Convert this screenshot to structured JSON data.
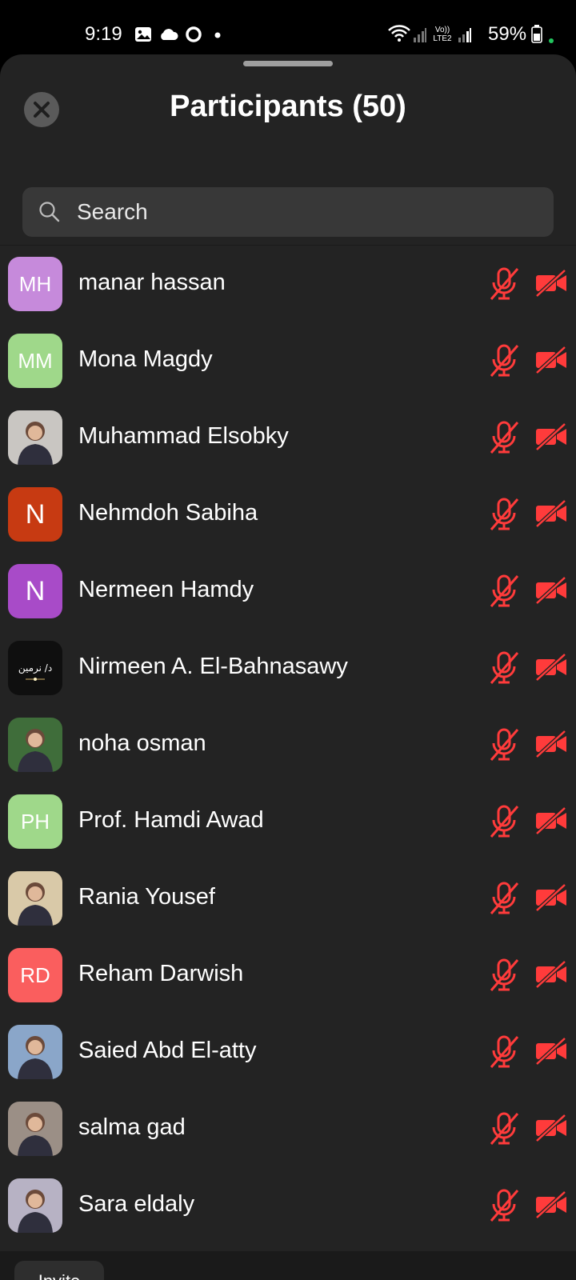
{
  "status_bar": {
    "time": "9:19",
    "battery": "59%",
    "network_label": "Vo)) LTE2",
    "icons": [
      "gallery-icon",
      "cloud-icon",
      "vodafone-icon",
      "dot-icon",
      "wifi-icon",
      "signal-icon",
      "battery-icon"
    ]
  },
  "header": {
    "title": "Participants (50)",
    "close_icon": "close-icon"
  },
  "search": {
    "placeholder": "Search",
    "value": ""
  },
  "colors": {
    "muted_red": "#ff3b3b",
    "sheet_bg": "#232323"
  },
  "participants": [
    {
      "name": "manar hassan",
      "initials": "MH",
      "avatar_color": "#c68adb",
      "avatar_type": "initials",
      "mic": "muted",
      "video": "off"
    },
    {
      "name": "Mona Magdy",
      "initials": "MM",
      "avatar_color": "#9fd88a",
      "avatar_type": "initials",
      "mic": "muted",
      "video": "off"
    },
    {
      "name": "Muhammad Elsobky",
      "initials": "",
      "avatar_color": "#c9c6c2",
      "avatar_type": "photo",
      "mic": "muted",
      "video": "off"
    },
    {
      "name": "Nehmdoh Sabiha",
      "initials": "N",
      "avatar_color": "#c73a12",
      "avatar_type": "initials",
      "mic": "muted",
      "video": "off"
    },
    {
      "name": "Nermeen Hamdy",
      "initials": "N",
      "avatar_color": "#a84bc8",
      "avatar_type": "initials",
      "mic": "muted",
      "video": "off"
    },
    {
      "name": "Nirmeen A. El-Bahnasawy",
      "initials": "",
      "avatar_color": "#0f0f0f",
      "avatar_type": "photo",
      "avatar_text": "د/ نرمين",
      "mic": "muted",
      "video": "off"
    },
    {
      "name": "noha osman",
      "initials": "",
      "avatar_color": "#3f6d3a",
      "avatar_type": "photo",
      "mic": "muted",
      "video": "off"
    },
    {
      "name": "Prof. Hamdi Awad",
      "initials": "PH",
      "avatar_color": "#9fd88a",
      "avatar_type": "initials",
      "mic": "muted",
      "video": "off"
    },
    {
      "name": "Rania Yousef",
      "initials": "",
      "avatar_color": "#d9c9a8",
      "avatar_type": "photo",
      "mic": "muted",
      "video": "off"
    },
    {
      "name": "Reham Darwish",
      "initials": "RD",
      "avatar_color": "#fa5e5e",
      "avatar_type": "initials",
      "mic": "muted",
      "video": "off"
    },
    {
      "name": "Saied Abd El-atty",
      "initials": "",
      "avatar_color": "#8aa6c9",
      "avatar_type": "photo",
      "mic": "muted",
      "video": "off"
    },
    {
      "name": "salma gad",
      "initials": "",
      "avatar_color": "#9b8f86",
      "avatar_type": "photo",
      "mic": "muted",
      "video": "off"
    },
    {
      "name": "Sara eldaly",
      "initials": "",
      "avatar_color": "#b7b2c4",
      "avatar_type": "photo",
      "mic": "muted",
      "video": "off"
    }
  ],
  "footer": {
    "invite_label": "Invite"
  }
}
